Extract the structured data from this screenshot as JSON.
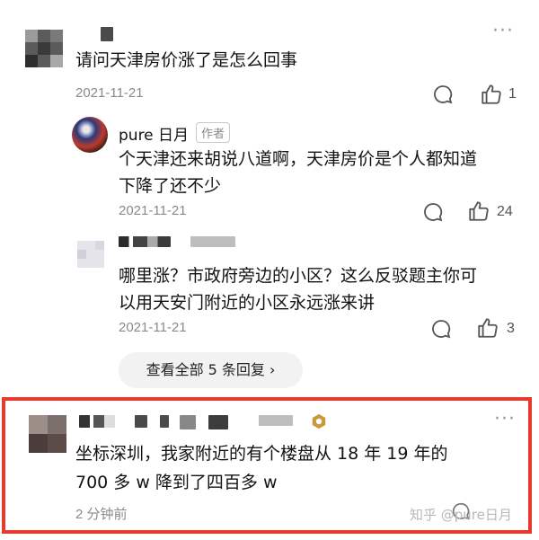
{
  "comments": [
    {
      "content": "请问天津房价涨了是怎么回事",
      "date": "2021-11-21",
      "like_count": "1"
    },
    {
      "author": "pure 日月",
      "author_badge": "作者",
      "content_line1": "个天津还来胡说八道啊，天津房价是个人都知道",
      "content_line2": "下降了还不少",
      "date": "2021-11-21",
      "like_count": "24"
    },
    {
      "content_line1": "哪里涨？市政府旁边的小区？这么反驳题主你可",
      "content_line2": "以用天安门附近的小区永远涨来讲",
      "date": "2021-11-21",
      "like_count": "3"
    },
    {
      "content_line1": "坐标深圳，我家附近的有个楼盘从 18 年 19 年的",
      "content_line2": "700 多 w 降到了四百多 w",
      "date": "2 分钟前"
    }
  ],
  "view_all_replies": "查看全部 5 条回复 ›",
  "watermark": "知乎 @pure日月",
  "colors": {
    "highlight_border": "#e8392f",
    "badge_gold": "#c99a3a"
  },
  "icons": [
    "reply-icon",
    "like-icon",
    "more-icon"
  ]
}
